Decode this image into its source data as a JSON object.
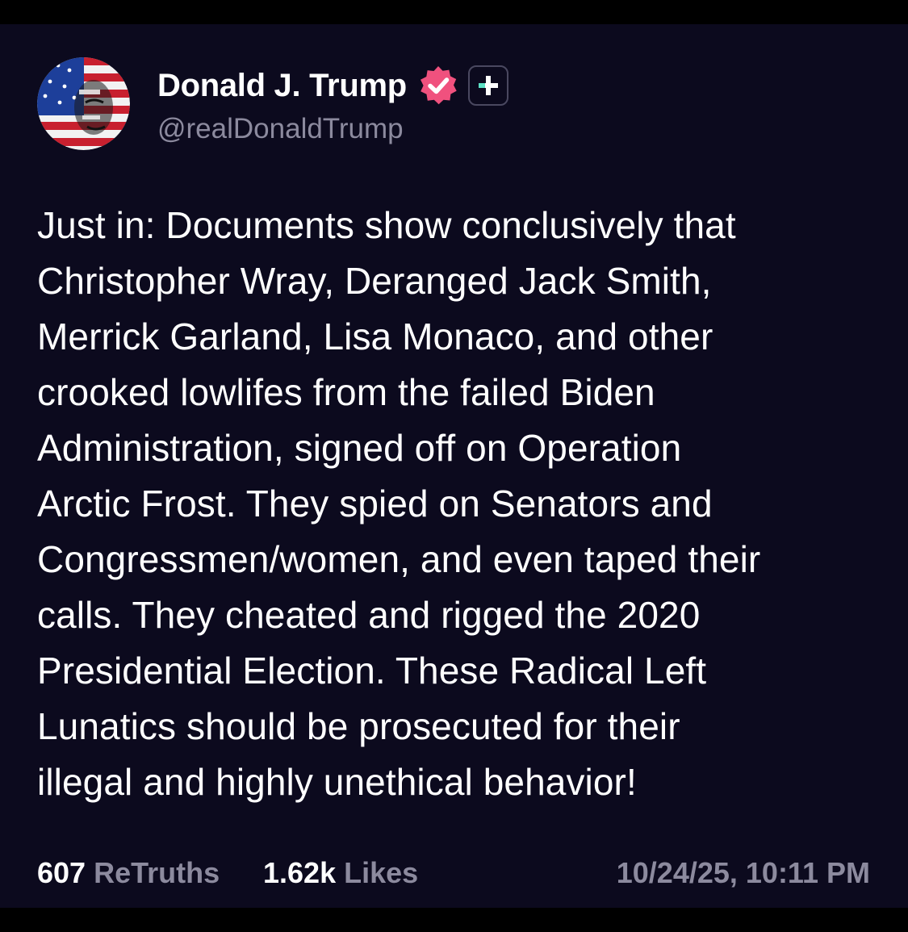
{
  "post": {
    "author": {
      "display_name": "Donald J. Trump",
      "handle": "@realDonaldTrump",
      "verified_color": "#f0517e"
    },
    "text_lines": [
      "Just in: Documents show conclusively that",
      "Christopher Wray, Deranged Jack Smith,",
      "Merrick Garland, Lisa Monaco, and other",
      "crooked lowlifes from the failed Biden",
      "Administration, signed off on Operation",
      "Arctic Frost. They spied on Senators and",
      "Congressmen/women, and even taped their",
      "calls. They cheated and rigged the 2020",
      "Presidential Election. These Radical Left",
      "Lunatics should be prosecuted for their",
      "illegal and highly unethical behavior!"
    ],
    "stats": {
      "retruths_count": "607",
      "retruths_label": "ReTruths",
      "likes_count": "1.62k",
      "likes_label": "Likes"
    },
    "timestamp": "10/24/25, 10:11 PM"
  },
  "theme": {
    "background": "#0c0a1e",
    "text": "#ffffff",
    "muted": "#8c8a9e"
  }
}
